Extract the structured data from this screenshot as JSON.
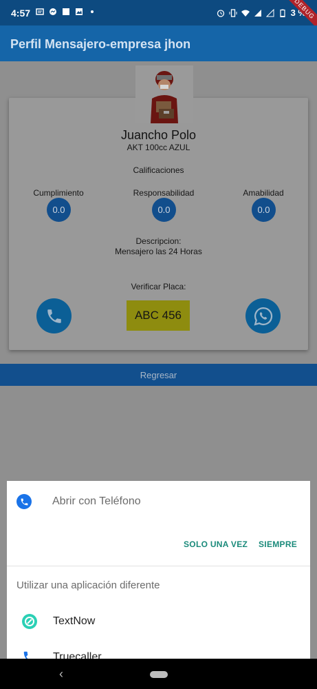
{
  "status_bar": {
    "time": "4:57",
    "battery": "3 %",
    "debug_badge": "DEBUG"
  },
  "app_bar": {
    "title": "Perfil Mensajero-empresa jhon"
  },
  "profile": {
    "name": "Juancho Polo",
    "vehicle": "AKT 100cc AZUL",
    "ratings_title": "Calificaciones",
    "ratings": [
      {
        "label": "Cumplimiento",
        "value": "0.0"
      },
      {
        "label": "Responsabilidad",
        "value": "0.0"
      },
      {
        "label": "Amabilidad",
        "value": "0.0"
      }
    ],
    "description_title": "Descripcion:",
    "description": "Mensajero las 24 Horas",
    "verify_label": "Verificar Placa:",
    "plate": "ABC 456",
    "back_label": "Regresar"
  },
  "sheet": {
    "open_with": "Abrir con Teléfono",
    "just_once": "SOLO UNA VEZ",
    "always": "SIEMPRE",
    "other_app_label": "Utilizar una aplicación diferente",
    "apps": [
      {
        "name": "TextNow",
        "icon": "textnow-icon"
      },
      {
        "name": "Truecaller",
        "icon": "truecaller-icon"
      }
    ]
  },
  "colors": {
    "app_bar": "#1565a8",
    "accent_text": "#1a8a7a"
  }
}
